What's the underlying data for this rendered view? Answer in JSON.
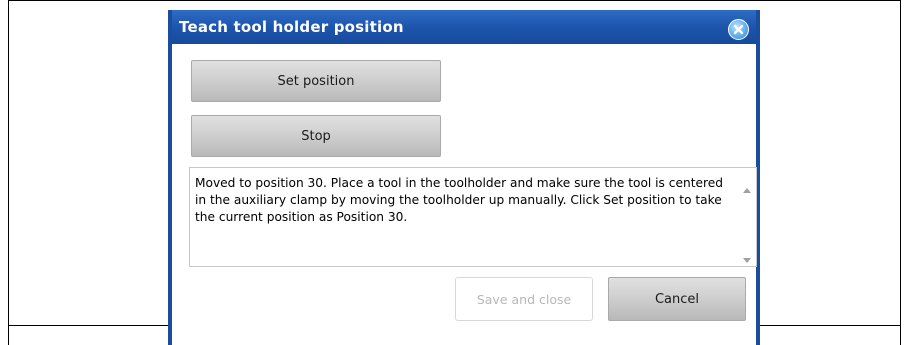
{
  "dialog": {
    "title": "Teach tool holder position",
    "close_icon": "close-icon",
    "buttons": {
      "set_position": "Set position",
      "stop": "Stop",
      "save_and_close": "Save and close",
      "cancel": "Cancel"
    },
    "message": "Moved to position 30. Place a tool in the toolholder and make sure the tool is centered in the auxiliary clamp by moving the toolholder up manually. Click Set position to take the current position as Position 30.",
    "colors": {
      "titlebar": "#1d55ad",
      "border": "#1a4d9e",
      "disabled_text": "#b8b8b8"
    }
  }
}
